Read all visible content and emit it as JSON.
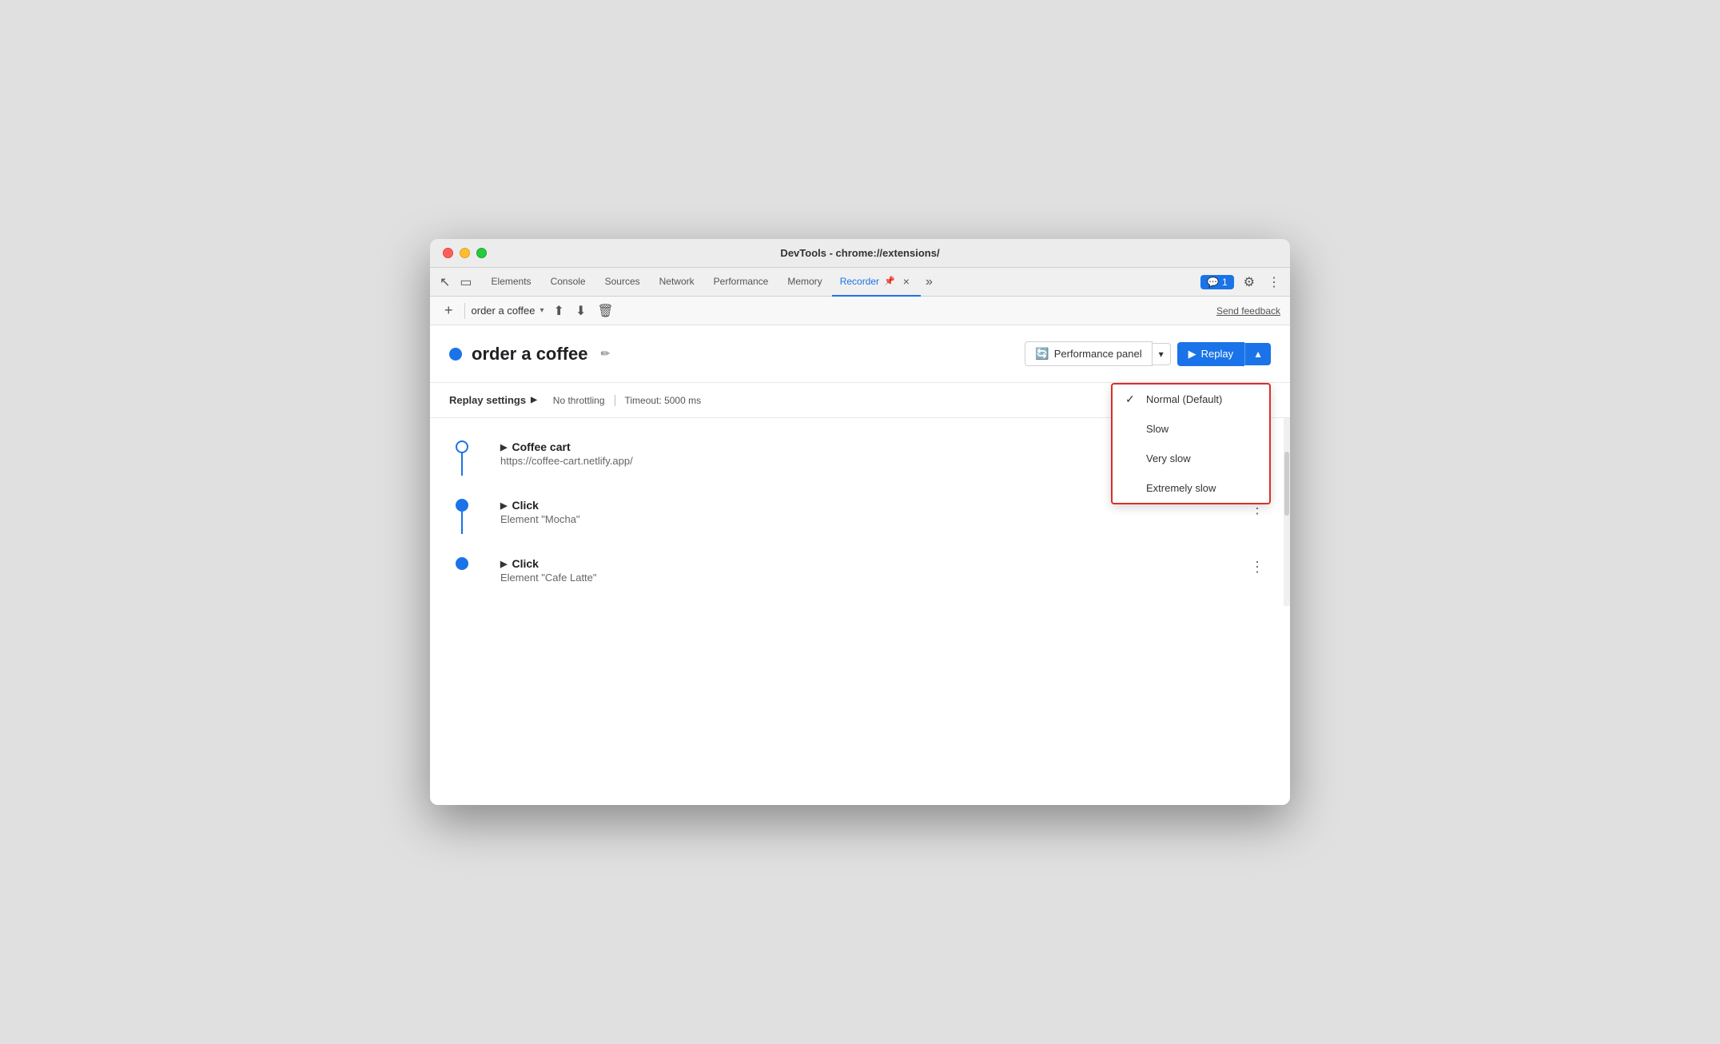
{
  "window": {
    "title": "DevTools - chrome://extensions/"
  },
  "tabs": {
    "items": [
      {
        "label": "Elements",
        "active": false
      },
      {
        "label": "Console",
        "active": false
      },
      {
        "label": "Sources",
        "active": false
      },
      {
        "label": "Network",
        "active": false
      },
      {
        "label": "Performance",
        "active": false
      },
      {
        "label": "Memory",
        "active": false
      },
      {
        "label": "Recorder",
        "active": true
      }
    ],
    "more_label": "»",
    "close_label": "×"
  },
  "devtools_right": {
    "feedback_count": "1",
    "gear_icon": "⚙",
    "more_icon": "⋮"
  },
  "toolbar": {
    "add_label": "+",
    "recording_name": "order a coffee",
    "dropdown_arrow": "▾",
    "send_feedback_label": "Send feedback"
  },
  "recording": {
    "title": "order a coffee",
    "edit_icon": "✏",
    "perf_panel_label": "Performance panel",
    "replay_label": "Replay",
    "replay_arrow": "▲",
    "perf_dropdown_arrow": "▾"
  },
  "dropdown": {
    "items": [
      {
        "label": "Normal (Default)",
        "checked": true
      },
      {
        "label": "Slow",
        "checked": false
      },
      {
        "label": "Very slow",
        "checked": false
      },
      {
        "label": "Extremely slow",
        "checked": false
      }
    ]
  },
  "replay_settings": {
    "title": "Replay settings",
    "arrow": "▶",
    "throttling": "No throttling",
    "timeout": "Timeout: 5000 ms"
  },
  "steps": [
    {
      "title": "Coffee cart",
      "subtitle": "https://coffee-cart.netlify.app/",
      "type": "navigate",
      "filled": false
    },
    {
      "title": "Click",
      "subtitle": "Element \"Mocha\"",
      "type": "click",
      "filled": true
    },
    {
      "title": "Click",
      "subtitle": "Element \"Cafe Latte\"",
      "type": "click",
      "filled": true
    }
  ],
  "colors": {
    "accent": "#1a73e8",
    "red_border": "#d93025",
    "normal_text": "#202124"
  }
}
